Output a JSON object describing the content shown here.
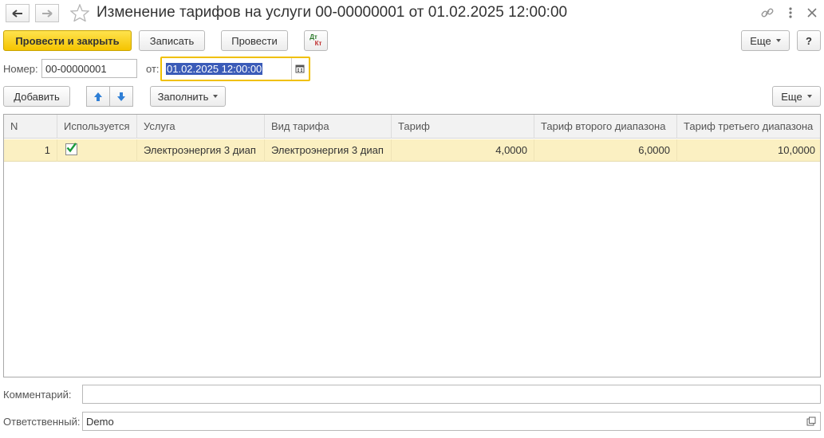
{
  "window": {
    "title": "Изменение тарифов на услуги 00-00000001 от 01.02.2025 12:00:00"
  },
  "toolbar": {
    "post_close_label": "Провести и закрыть",
    "save_label": "Записать",
    "post_label": "Провести",
    "dtkt_top": "Дт",
    "dtkt_bottom": "Кт",
    "more_label": "Еще",
    "help_label": "?"
  },
  "header": {
    "number_label": "Номер:",
    "number_value": "00-00000001",
    "date_label": "от:",
    "date_value": "01.02.2025 12:00:00"
  },
  "table_toolbar": {
    "add_label": "Добавить",
    "fill_label": "Заполнить",
    "more_label": "Еще"
  },
  "table": {
    "columns": [
      "N",
      "Используется",
      "Услуга",
      "Вид тарифа",
      "Тариф",
      "Тариф второго диапазона",
      "Тариф третьего диапазона"
    ],
    "rows": [
      {
        "n": "1",
        "used": true,
        "service": "Электроэнергия 3 диап",
        "tariff_type": "Электроэнергия 3 диап",
        "tariff": "4,0000",
        "tariff2": "6,0000",
        "tariff3": "10,0000"
      }
    ]
  },
  "footer": {
    "comment_label": "Комментарий:",
    "comment_value": "",
    "responsible_label": "Ответственный:",
    "responsible_value": "Demo"
  },
  "colors": {
    "primary_button": "#f5c400",
    "selected_row": "#fbf0c2",
    "focus_border": "#f0c000",
    "selection": "#3a5bb8",
    "check": "#1a9a3a"
  }
}
